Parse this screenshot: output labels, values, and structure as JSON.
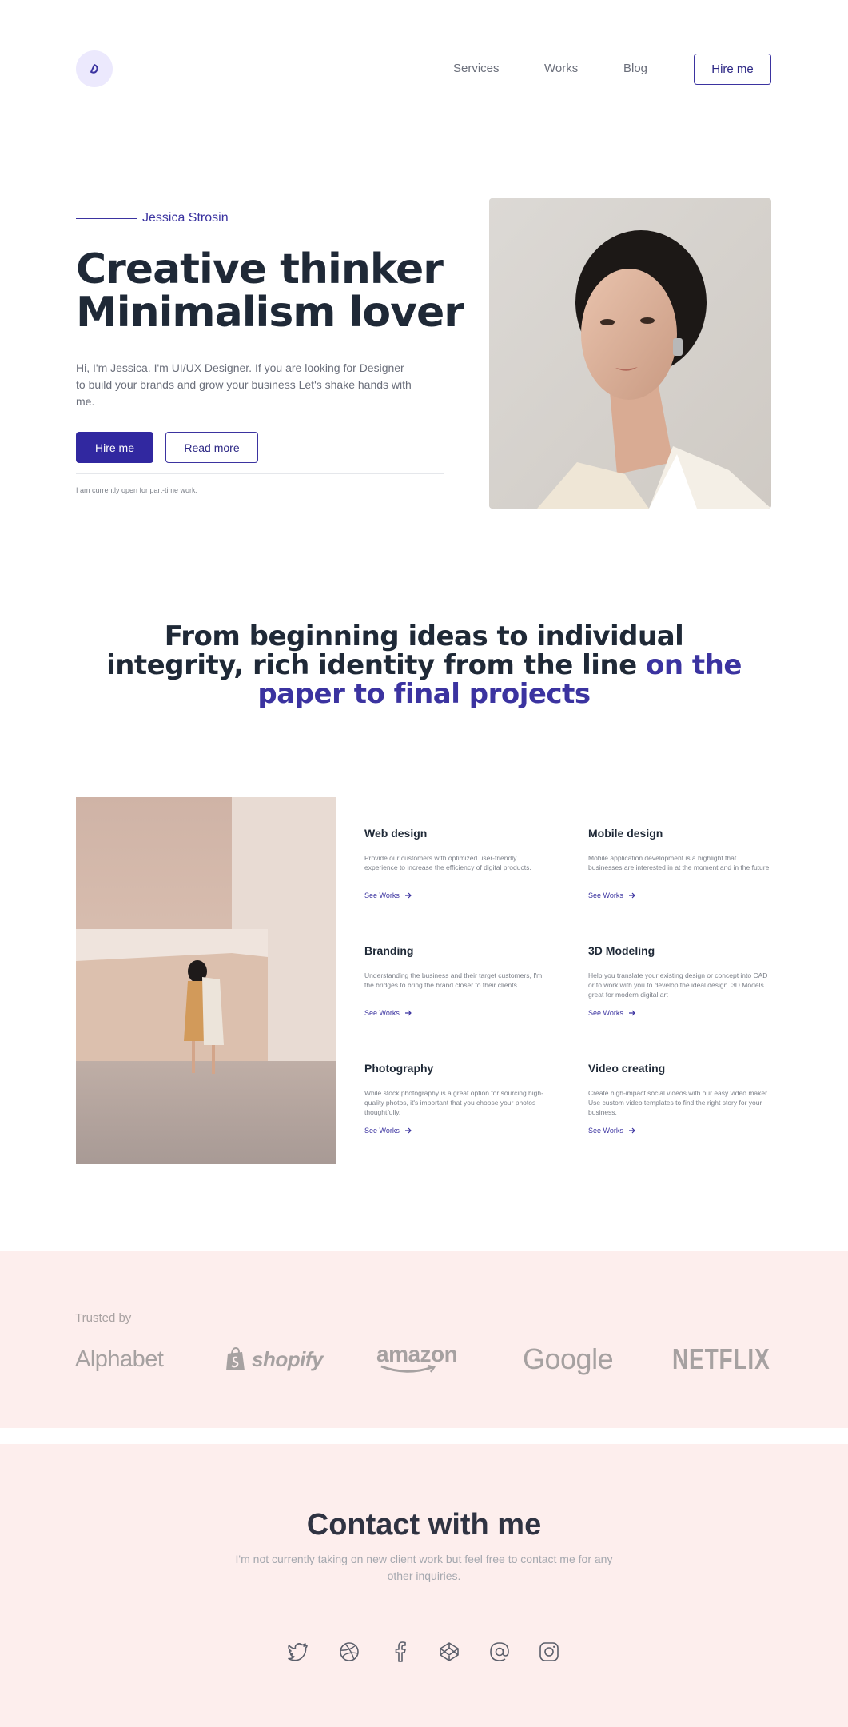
{
  "header": {
    "nav": [
      "Services",
      "Works",
      "Blog"
    ],
    "hire_label": "Hire me"
  },
  "hero": {
    "name": "Jessica Strosin",
    "title_line1": "Creative thinker",
    "title_line2": "Minimalism lover",
    "description": "Hi, I'm Jessica. I'm UI/UX Designer. If you are looking for Designer to build your brands and grow your business Let's shake hands with me.",
    "primary_button": "Hire me",
    "secondary_button": "Read more",
    "note": "I am currently open for part-time work."
  },
  "statement": {
    "part1": "From beginning ideas to individual integrity, rich identity from the line ",
    "accent": "on the paper to final projects"
  },
  "services": [
    {
      "title": "Web design",
      "description": "Provide our customers with optimized user-friendly experience to increase the efficiency of digital products.",
      "link": "See Works"
    },
    {
      "title": "Mobile design",
      "description": "Mobile application development is a highlight that businesses are interested in at the moment and in the future.",
      "link": "See Works"
    },
    {
      "title": "Branding",
      "description": "Understanding the business and their target customers, I'm the bridges to bring the brand closer to their clients.",
      "link": "See Works"
    },
    {
      "title": "3D Modeling",
      "description": "Help you translate your existing design or concept into CAD or to work with you to develop the ideal design. 3D Models great for modern digital art",
      "link": "See Works"
    },
    {
      "title": "Photography",
      "description": "While stock photography is a great option for sourcing high-quality photos, it's important that you choose your photos thoughtfully.",
      "link": "See Works"
    },
    {
      "title": "Video creating",
      "description": "Create high-impact social videos with our easy video maker. Use custom video templates to find the right story for your business.",
      "link": "See Works"
    }
  ],
  "trusted": {
    "label": "Trusted by",
    "brands": [
      "Alphabet",
      "shopify",
      "amazon",
      "Google",
      "NETFLIX"
    ]
  },
  "contact": {
    "title": "Contact with me",
    "description": "I'm not currently taking on new client work but feel free to contact me for any other inquiries.",
    "socials": [
      "twitter-icon",
      "dribbble-icon",
      "facebook-icon",
      "codepen-icon",
      "at-sign-icon",
      "instagram-icon"
    ]
  },
  "colors": {
    "accent": "#3128a0",
    "heading": "#1f2937",
    "muted": "#6b6f7b",
    "blush_bg": "#fdeeed",
    "logo_bg": "#ece9fd"
  }
}
